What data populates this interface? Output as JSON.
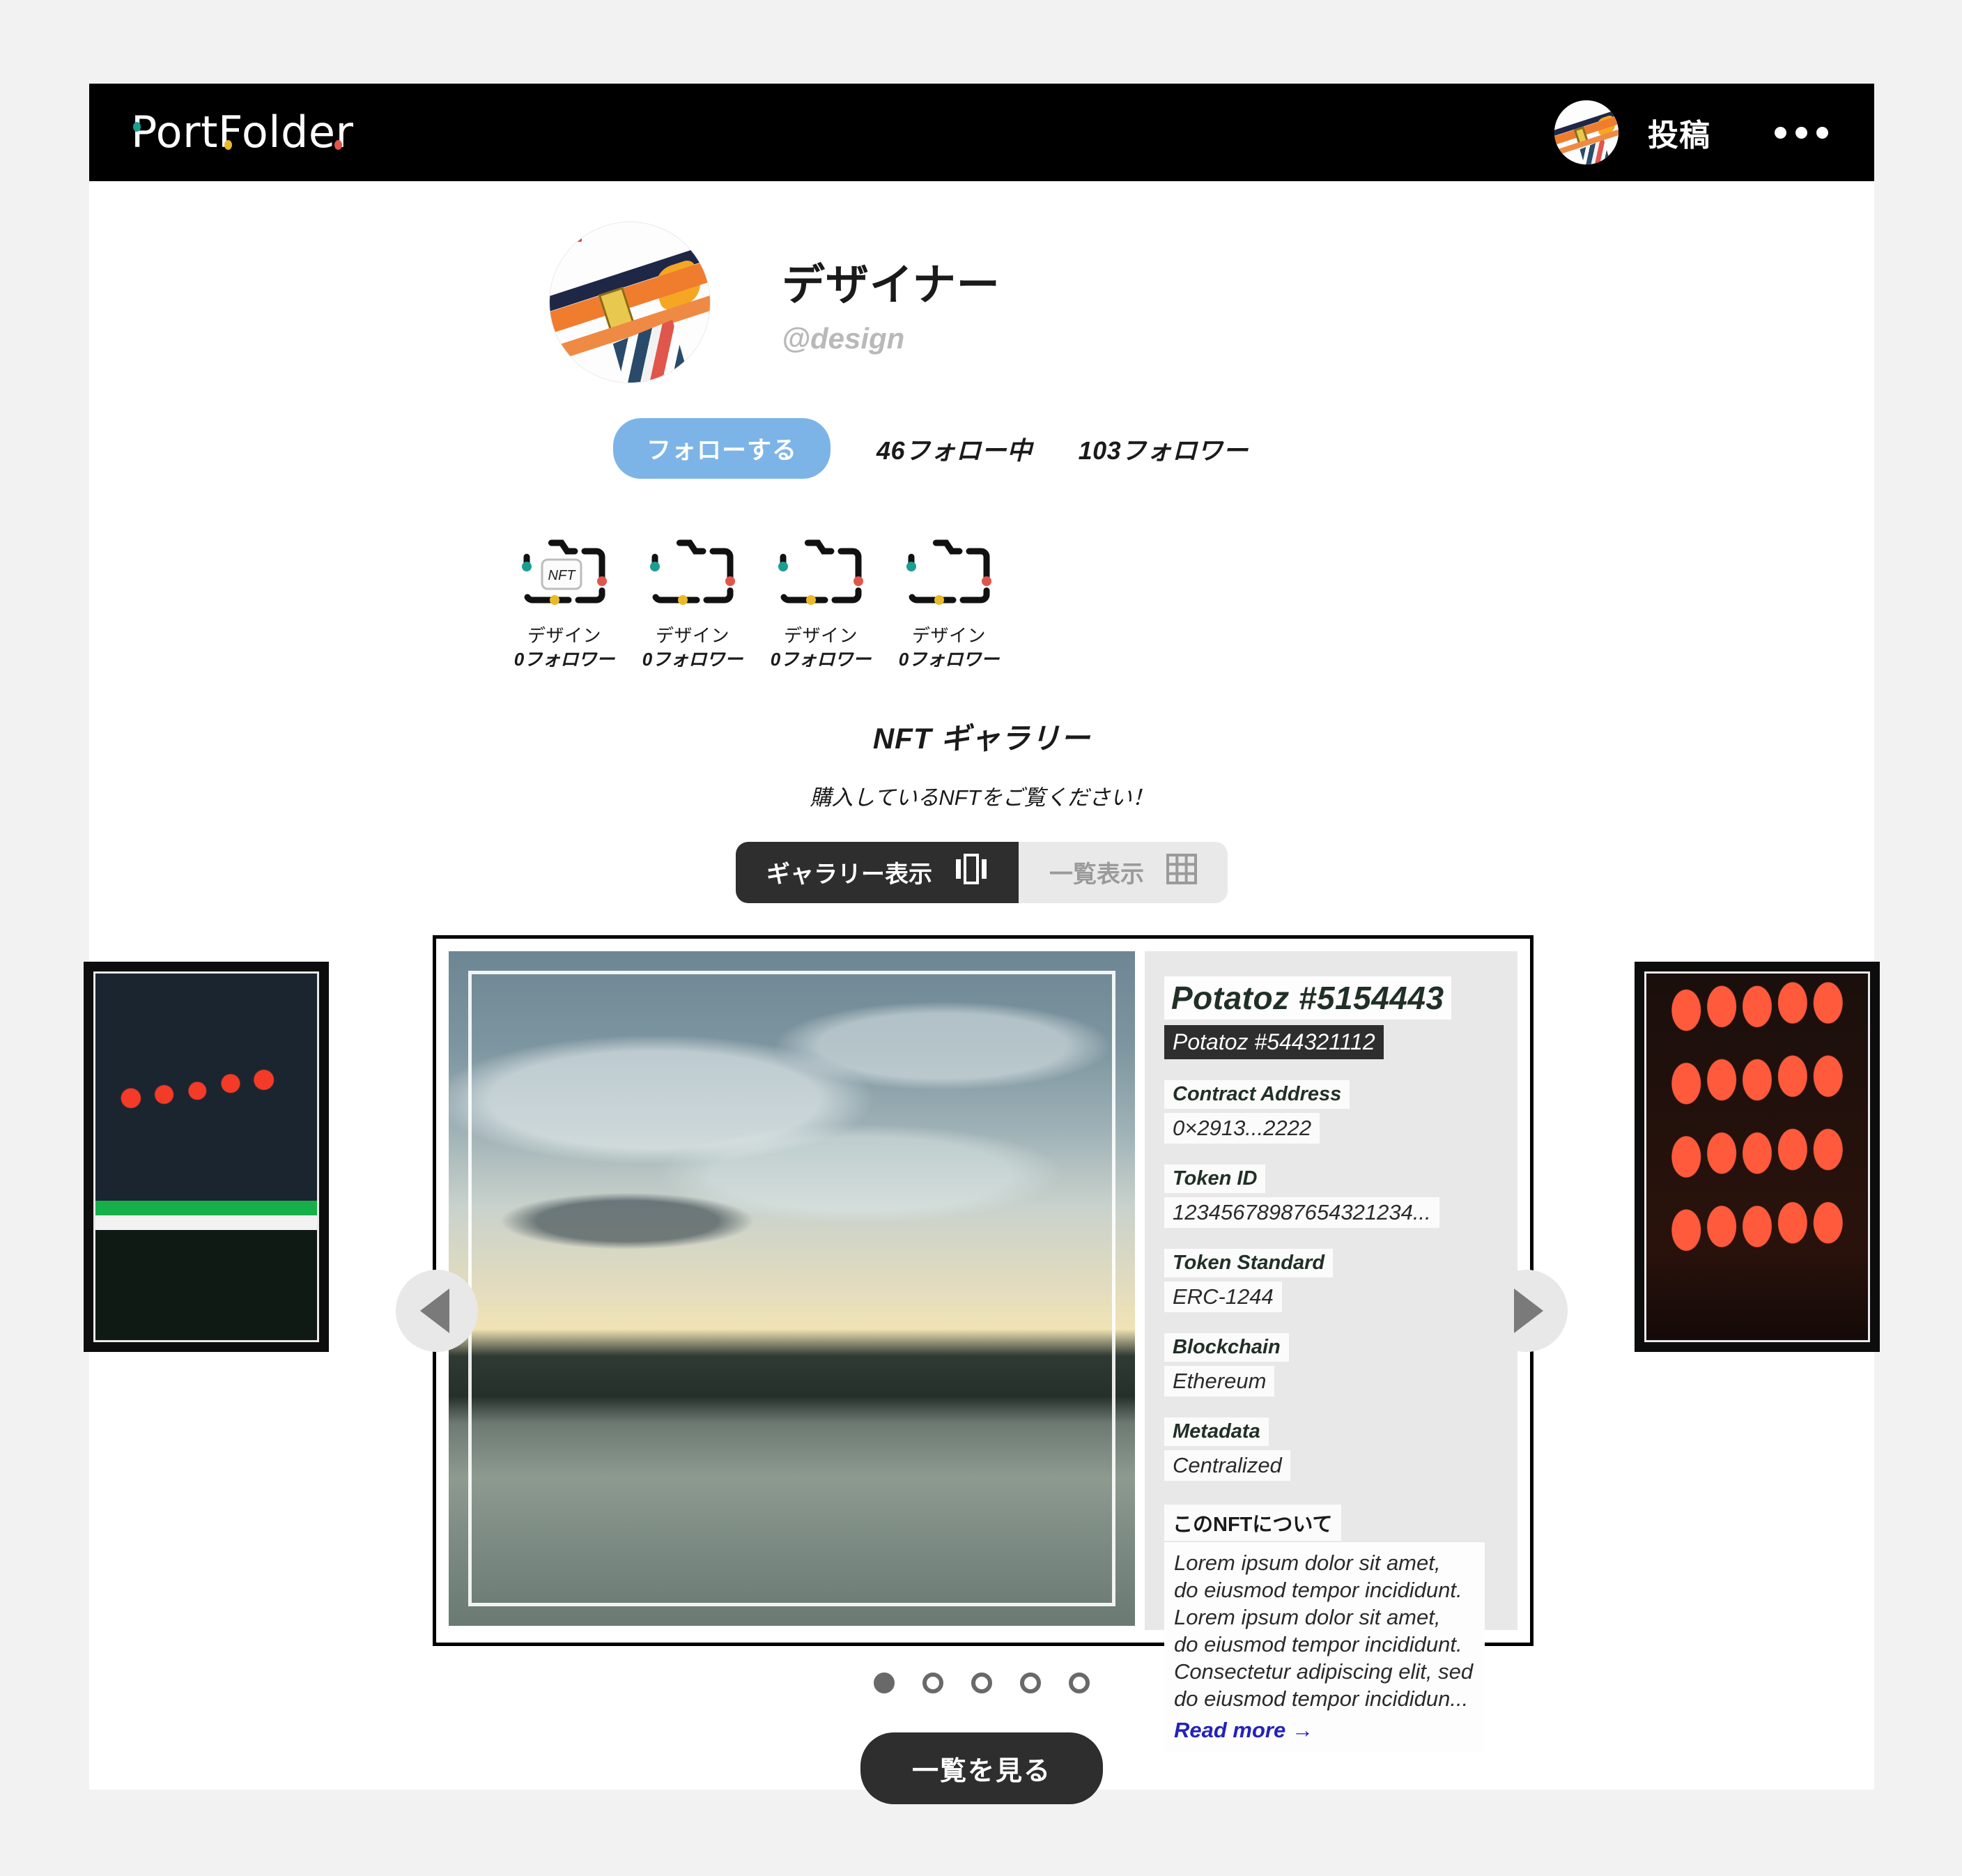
{
  "header": {
    "logo_text": "PortFolder",
    "logo_dot_teal": "#1a9e8f",
    "logo_dot_yellow": "#e8b92a",
    "logo_dot_red": "#e0564d",
    "post_label": "投稿",
    "avatar_name": "user-avatar",
    "more_label": "•••"
  },
  "profile": {
    "display_name": "デザイナー",
    "handle": "@design",
    "follow_button": "フォローする",
    "follow_button_color": "#7cb4e8",
    "following": "46フォロー中",
    "followers": "103フォロワー"
  },
  "folders": [
    {
      "badge": "NFT",
      "name": "デザイン",
      "followers": "0フォロワー"
    },
    {
      "badge": "",
      "name": "デザイン",
      "followers": "0フォロワー"
    },
    {
      "badge": "",
      "name": "デザイン",
      "followers": "0フォロワー"
    },
    {
      "badge": "",
      "name": "デザイン",
      "followers": "0フォロワー"
    }
  ],
  "gallery": {
    "title": "NFT ギャラリー",
    "subtitle": "購入しているNFTをご覧ください！",
    "view_toggle": {
      "gallery_label": "ギャラリー表示",
      "list_label": "一覧表示",
      "active": "gallery"
    },
    "prev_label": "◀",
    "next_label": "▶",
    "dots_total": 5,
    "dots_active_index": 0,
    "view_all_button": "一覧を見る"
  },
  "nft": {
    "title": "Potatoz #5154443",
    "subtitle": "Potatoz #544321112",
    "fields": [
      {
        "label": "Contract Address",
        "value": "0×2913...2222"
      },
      {
        "label": "Token ID",
        "value": "12345678987654321234..."
      },
      {
        "label": "Token Standard",
        "value": "ERC-1244"
      },
      {
        "label": "Blockchain",
        "value": "Ethereum"
      },
      {
        "label": "Metadata",
        "value": "Centralized"
      }
    ],
    "about_heading": "このNFTについて",
    "about_line1": "Lorem ipsum dolor sit amet,",
    "about_line2": "do eiusmod tempor incididunt.",
    "about_line3": "Lorem ipsum dolor sit amet,",
    "about_line4": "do eiusmod tempor incididunt.",
    "about_line5": "Consectetur adipiscing elit, sed",
    "about_line6": "do eiusmod tempor incididun...",
    "read_more": "Read more →",
    "read_more_color": "#2222bb"
  }
}
